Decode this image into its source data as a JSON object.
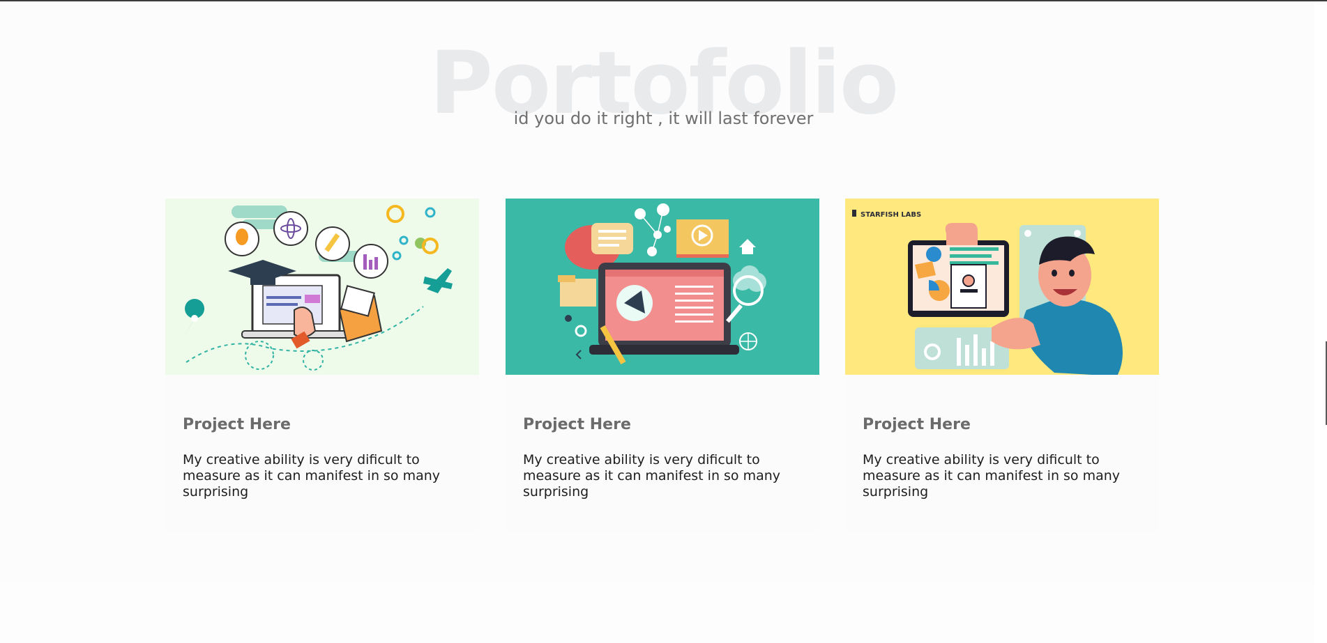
{
  "portfolio": {
    "title": "Portofolio",
    "subtitle": "id you do it right , it will last forever"
  },
  "projects": [
    {
      "title": "Project Here",
      "description": "My creative ability is very dificult to measure as it can manifest in so many surprising",
      "image_theme": "education-laptop",
      "image_bg": "#eefaea"
    },
    {
      "title": "Project Here",
      "description": "My creative ability is very dificult to measure as it can manifest in so many surprising",
      "image_theme": "digital-marketing",
      "image_bg": "#3ab9a6"
    },
    {
      "title": "Project Here",
      "description": "My creative ability is very dificult to measure as it can manifest in so many surprising",
      "image_theme": "tablet-presenter",
      "image_bg": "#ffe97f",
      "logo_text": "STARFISH LABS"
    }
  ],
  "colors": {
    "title_watermark": "#e9eaec",
    "subtitle": "#6f6f6f",
    "card_title": "#6b6b6b",
    "card_text": "#1d1d1d"
  }
}
